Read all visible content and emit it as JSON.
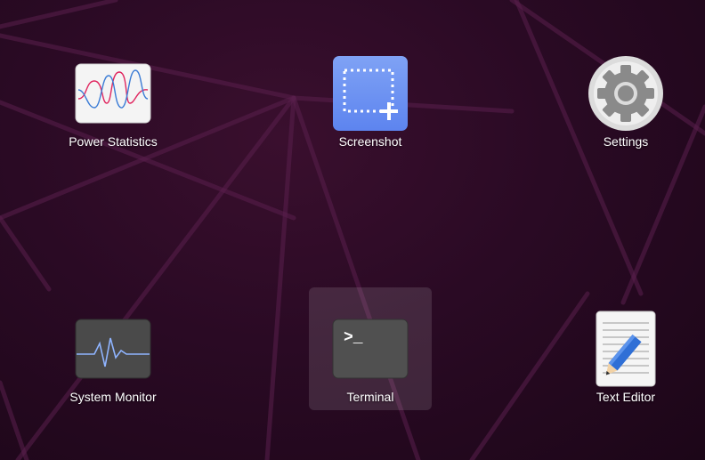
{
  "apps": [
    {
      "name": "power-statistics",
      "label": "Power Statistics",
      "icon": "power-statistics-icon"
    },
    {
      "name": "screenshot",
      "label": "Screenshot",
      "icon": "screenshot-icon"
    },
    {
      "name": "settings",
      "label": "Settings",
      "icon": "settings-icon"
    },
    {
      "name": "system-monitor",
      "label": "System Monitor",
      "icon": "system-monitor-icon"
    },
    {
      "name": "terminal",
      "label": "Terminal",
      "icon": "terminal-icon",
      "selected": true
    },
    {
      "name": "text-editor",
      "label": "Text Editor",
      "icon": "text-editor-icon"
    }
  ],
  "terminal_prompt": ">_",
  "colors": {
    "background": "#2a0a24",
    "label": "#ffffff",
    "selection": "rgba(255,255,255,0.12)"
  }
}
